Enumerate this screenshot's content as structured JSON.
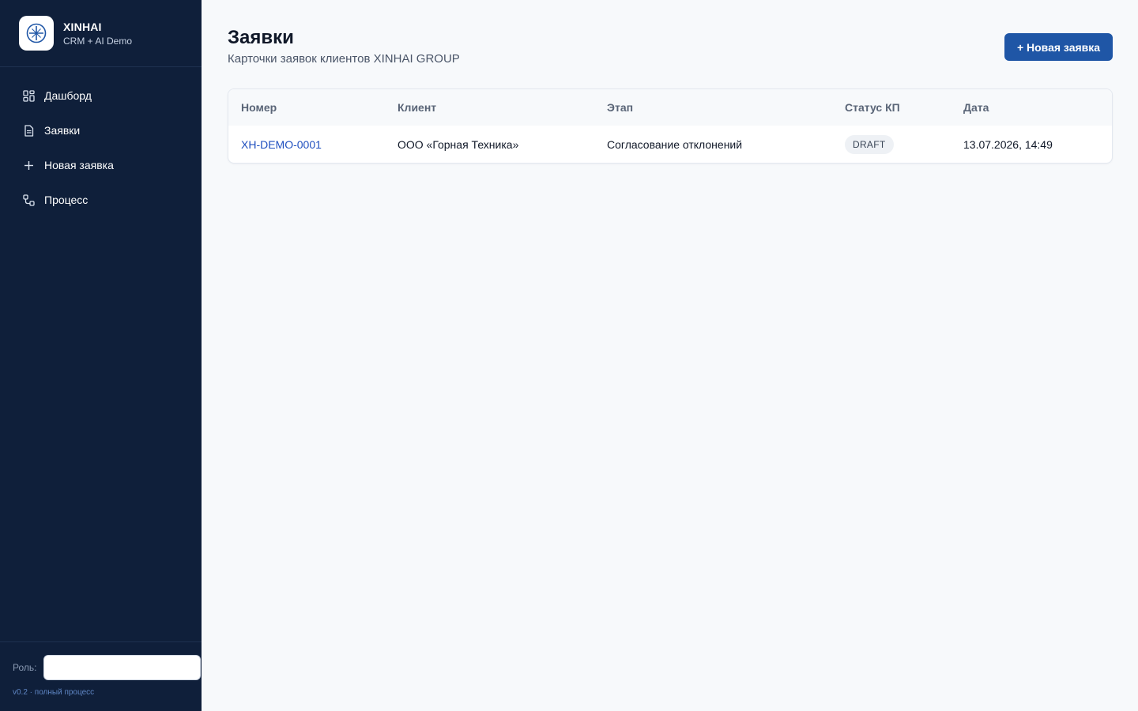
{
  "brand": {
    "name": "XINHAI",
    "subtitle": "CRM + AI Demo"
  },
  "sidebar": {
    "items": [
      {
        "label": "Дашборд",
        "icon": "dashboard-grid-icon"
      },
      {
        "label": "Заявки",
        "icon": "document-icon"
      },
      {
        "label": "Новая заявка",
        "icon": "plus-icon"
      },
      {
        "label": "Процесс",
        "icon": "process-flow-icon"
      }
    ],
    "role_label": "Роль:",
    "role_value": "",
    "version": "v0.2 · полный процесс"
  },
  "page": {
    "title": "Заявки",
    "subtitle": "Карточки заявок клиентов XINHAI GROUP",
    "new_button_label": "+ Новая заявка"
  },
  "table": {
    "columns": [
      "Номер",
      "Клиент",
      "Этап",
      "Статус КП",
      "Дата"
    ],
    "rows": [
      {
        "number": "XH-DEMO-0001",
        "client": "ООО «Горная Техника»",
        "stage": "Согласование отклонений",
        "status": "DRAFT",
        "date": "13.07.2026, 14:49"
      }
    ]
  },
  "colors": {
    "sidebar_bg": "#0f1f3a",
    "accent": "#1f56a6",
    "link": "#1f4fbf",
    "page_bg": "#f7f9fb"
  }
}
